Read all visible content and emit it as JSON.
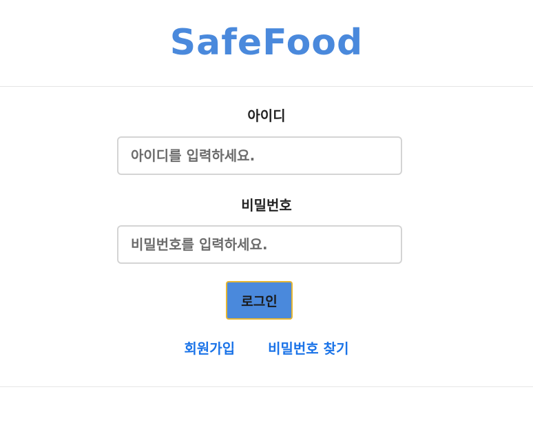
{
  "header": {
    "brand": "SafeFood"
  },
  "login_form": {
    "id_label": "아이디",
    "id_placeholder": "아이디를 입력하세요.",
    "password_label": "비밀번호",
    "password_placeholder": "비밀번호를 입력하세요.",
    "login_button": "로그인"
  },
  "links": {
    "signup": "회원가입",
    "find_password": "비밀번호 찾기"
  },
  "colors": {
    "brand": "#4a89dc",
    "link": "#1a73e8",
    "button_border": "#e6b632"
  }
}
